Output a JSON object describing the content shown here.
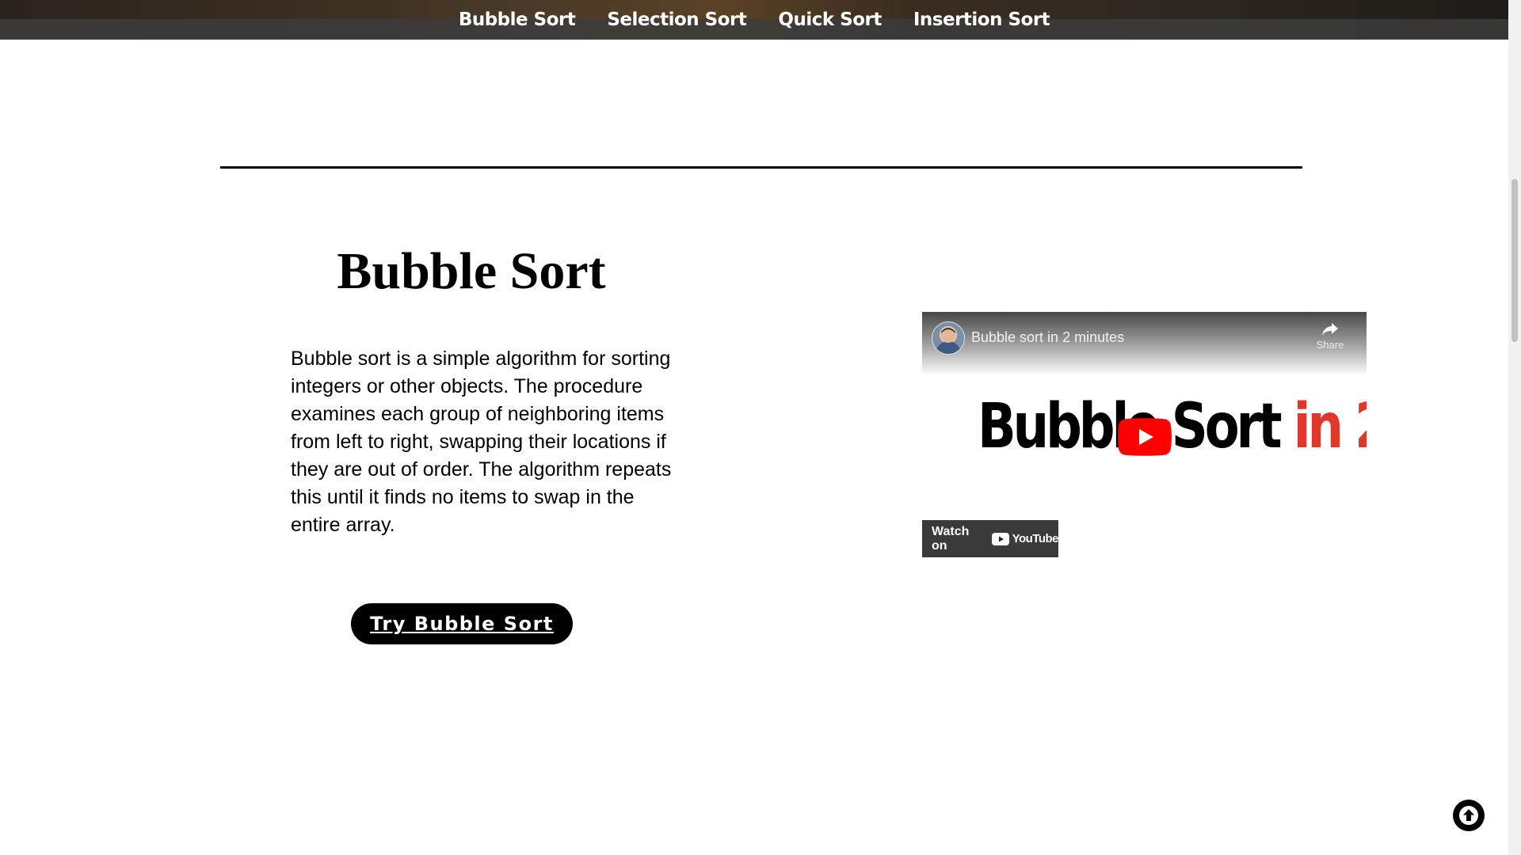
{
  "nav": {
    "items": [
      {
        "label": "Bubble Sort"
      },
      {
        "label": "Selection Sort"
      },
      {
        "label": "Quick Sort"
      },
      {
        "label": "Insertion Sort"
      }
    ]
  },
  "main": {
    "title": "Bubble Sort",
    "description": "Bubble sort is a simple algorithm for sorting integers or other objects. The procedure examines each group of neighboring items from left to right, swapping their locations if they are out of order. The algorithm repeats this until it finds no items to swap in the entire array.",
    "button_label": "Try Bubble Sort"
  },
  "video": {
    "title": "Bubble sort in 2 minutes",
    "share_label": "Share",
    "thumbnail_text_main": "Bubble Sort",
    "thumbnail_text_accent": "in 2",
    "watch_on_label": "Watch on",
    "youtube_label": "YouTube"
  },
  "colors": {
    "accent_red": "#e0372b",
    "youtube_red": "#ff0000",
    "button_bg": "#000000"
  },
  "icons": {
    "share": "share-icon",
    "play": "play-icon",
    "back_to_top": "arrow-up-icon"
  }
}
